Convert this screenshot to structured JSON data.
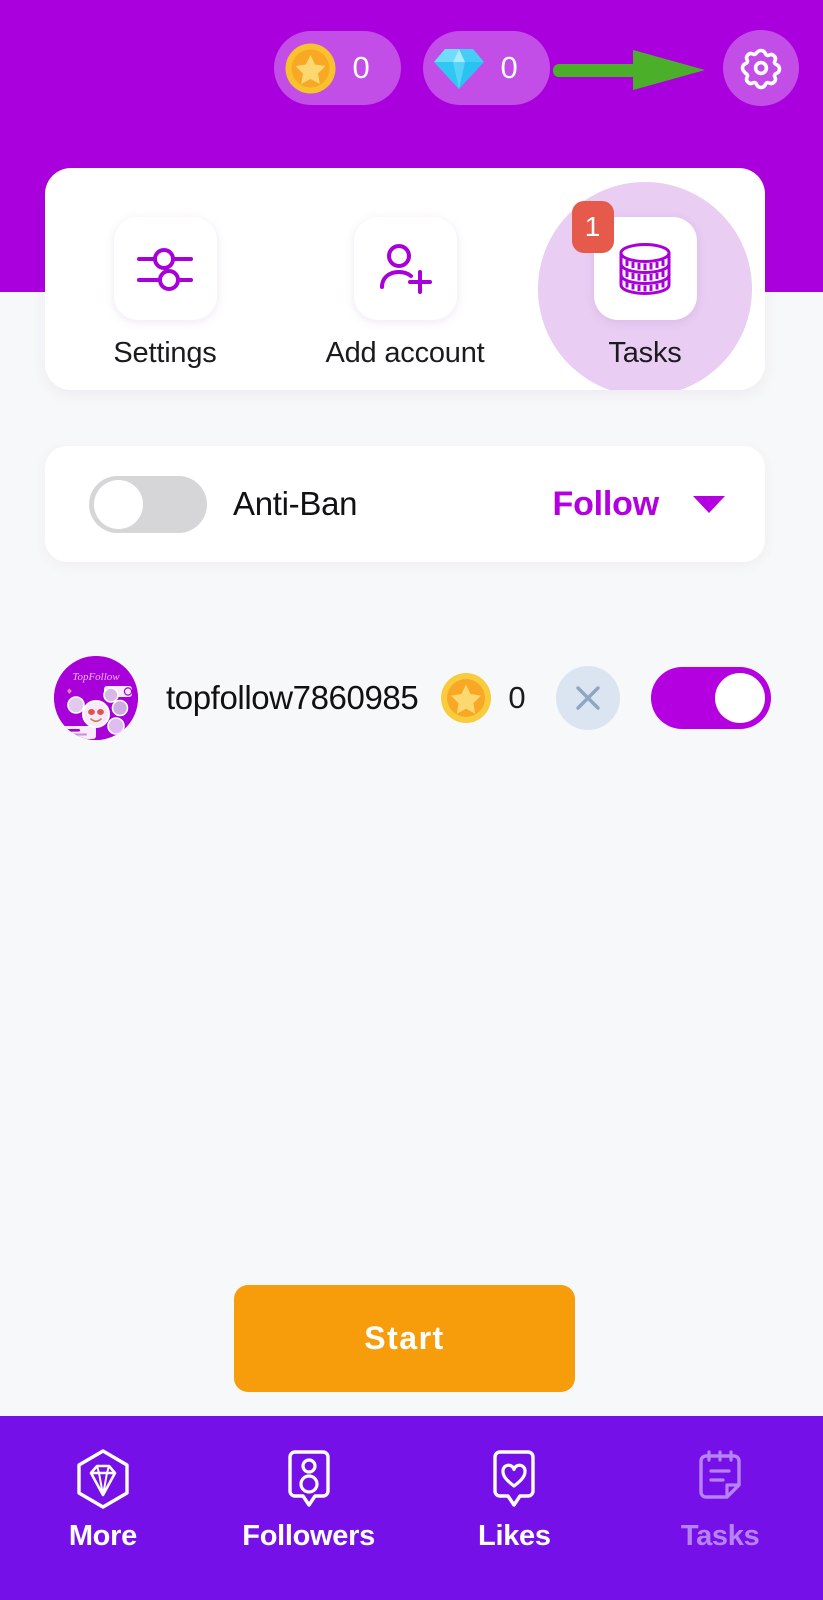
{
  "colors": {
    "header_purple": "#aa00dd",
    "nav_purple": "#7510e8",
    "accent_purple": "#b400e0",
    "start_orange": "#f79d0c",
    "badge_red": "#e55a4a",
    "page_bg": "#f7f8f9",
    "tasks_highlight": "#e9cdf2",
    "coin_gold": "#f9c228",
    "gem_blue": "#3bc8f5"
  },
  "header": {
    "coin_pill": {
      "icon": "star-coin-icon",
      "value": "0"
    },
    "gem_pill": {
      "icon": "diamond-gem-icon",
      "value": "0"
    },
    "settings_button": {
      "icon": "gear-icon"
    },
    "annotation_arrow": {
      "icon": "green-arrow-annotation",
      "color": "#4caf29"
    }
  },
  "actions": [
    {
      "id": "settings",
      "label": "Settings",
      "icon": "sliders-icon",
      "badge": null,
      "highlighted": false
    },
    {
      "id": "add-account",
      "label": "Add account",
      "icon": "person-add-icon",
      "badge": null,
      "highlighted": false
    },
    {
      "id": "tasks",
      "label": "Tasks",
      "icon": "coin-stack-icon",
      "badge": "1",
      "highlighted": true
    }
  ],
  "antiban": {
    "toggle_state": "off",
    "label": "Anti-Ban",
    "mode_value": "Follow",
    "dropdown_icon": "chevron-down-icon"
  },
  "account": {
    "avatar": "topfollow-avatar",
    "avatar_brand_text": "TopFollow",
    "username": "topfollow7860985",
    "coin_icon": "star-coin-icon",
    "coin_value": "0",
    "remove_icon": "close-x-icon",
    "toggle_state": "on"
  },
  "start_button": {
    "label": "Start"
  },
  "bottom_nav": [
    {
      "id": "more",
      "label": "More",
      "icon": "diamond-pin-icon",
      "active": true
    },
    {
      "id": "followers",
      "label": "Followers",
      "icon": "person-pin-icon",
      "active": true
    },
    {
      "id": "likes",
      "label": "Likes",
      "icon": "heart-pin-icon",
      "active": true
    },
    {
      "id": "tasks",
      "label": "Tasks",
      "icon": "note-list-icon",
      "active": false
    }
  ]
}
